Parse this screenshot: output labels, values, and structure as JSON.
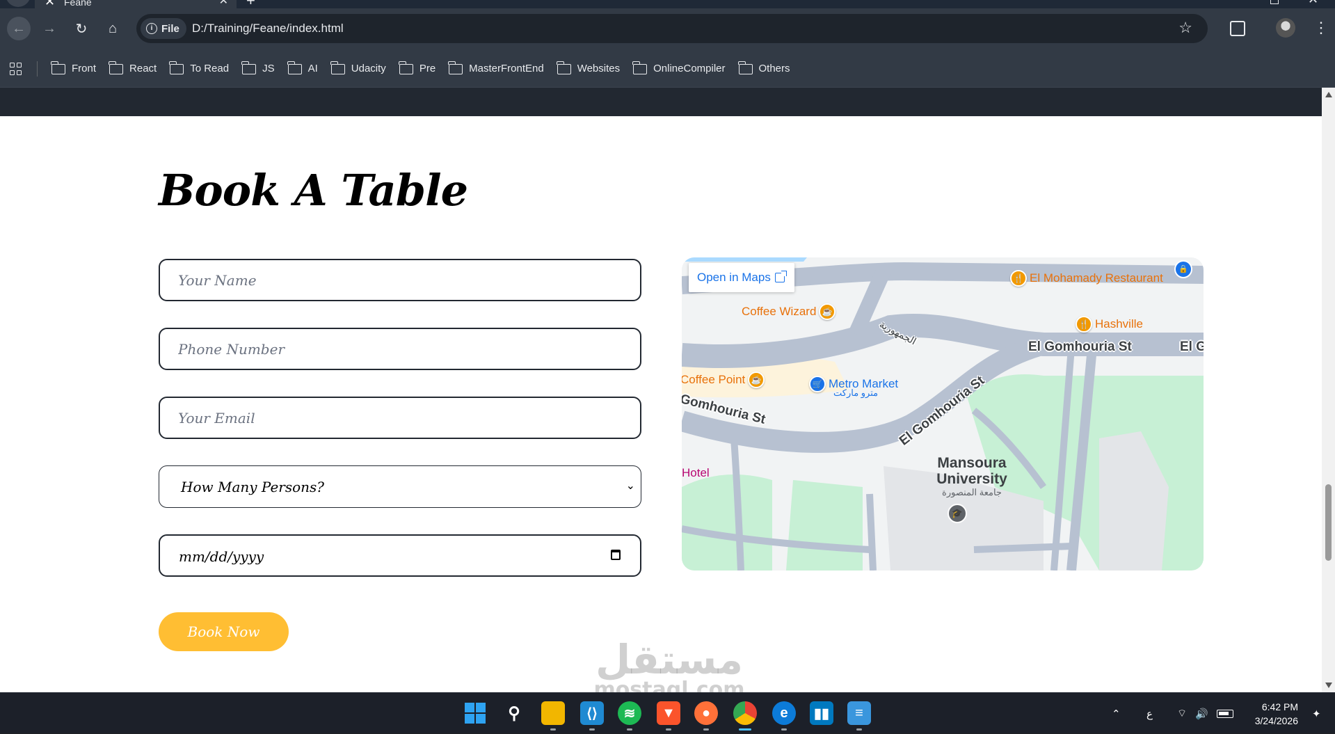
{
  "browser": {
    "tab_title": "Feane",
    "tab_favicon": "x-logo-icon",
    "url_scheme_label": "File",
    "url": "D:/Training/Feane/index.html",
    "bookmarks": [
      "Front",
      "React",
      "To Read",
      "JS",
      "AI",
      "Udacity",
      "Pre",
      "MasterFrontEnd",
      "Websites",
      "OnlineCompiler",
      "Others"
    ]
  },
  "page": {
    "heading": "Book A Table",
    "form": {
      "name_placeholder": "Your Name",
      "phone_placeholder": "Phone Number",
      "email_placeholder": "Your Email",
      "persons_selected": "How Many Persons?",
      "date_placeholder": "mm/dd/yyyy",
      "submit_label": "Book Now"
    },
    "map": {
      "open_in_maps": "Open in Maps",
      "places": {
        "el_mohamady": "El Mohamady Restaurant",
        "coffee_wizard": "Coffee Wizard",
        "hashville": "Hashville",
        "coffee_point": "Coffee Point",
        "metro_market": "Metro Market",
        "metro_market_ar": "مترو ماركت",
        "hotel": "Hotel",
        "university": "Mansoura University",
        "university_ar": "جامعة المنصورة"
      },
      "roads": {
        "r1": "El Gomhouria St",
        "r1_cut": "El G",
        "r2": "El Gomhouria St",
        "r3": "Gomhouria St",
        "r_ar": "الجمهورية"
      }
    },
    "colors": {
      "accent": "#ffbe33",
      "dark": "#222831"
    }
  },
  "watermark": {
    "arabic": "مستقل",
    "latin": "mostaql.com"
  },
  "taskbar": {
    "apps": [
      "start",
      "search",
      "file-explorer",
      "vscode",
      "spotify",
      "brave",
      "firefox",
      "chrome",
      "edge",
      "trello",
      "notepad"
    ],
    "active_app": "chrome",
    "ime": "ع",
    "time": "6:42 PM",
    "date": "3/24/2026"
  }
}
